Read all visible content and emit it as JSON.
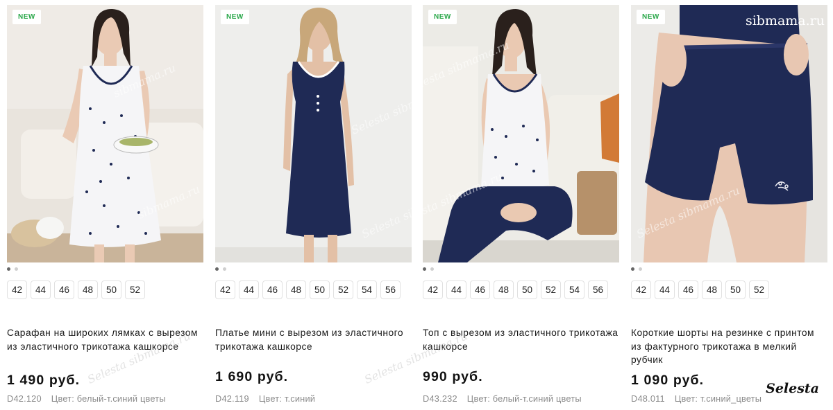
{
  "watermarks": {
    "top_right": "sibmama.ru",
    "diagonal_1": "Selesta sibmama.ru",
    "diagonal_2": "sibmama.ru",
    "signature": "Selesta"
  },
  "products": [
    {
      "badge": "NEW",
      "sizes": [
        "42",
        "44",
        "46",
        "48",
        "50",
        "52"
      ],
      "title": "Сарафан на широких лямках с вырезом из эластичного трикотажа кашкорсе",
      "price": "1 490 руб.",
      "article": "D42.120",
      "color": "Цвет: белый-т.синий цветы"
    },
    {
      "badge": "NEW",
      "sizes": [
        "42",
        "44",
        "46",
        "48",
        "50",
        "52",
        "54",
        "56"
      ],
      "title": "Платье мини с вырезом из эластичного трикотажа кашкорсе",
      "price": "1 690 руб.",
      "article": "D42.119",
      "color": "Цвет: т.синий"
    },
    {
      "badge": "NEW",
      "sizes": [
        "42",
        "44",
        "46",
        "48",
        "50",
        "52",
        "54",
        "56"
      ],
      "title": "Топ с вырезом из эластичного трикотажа кашкорсе",
      "price": "990 руб.",
      "article": "D43.232",
      "color": "Цвет: белый-т.синий цветы"
    },
    {
      "badge": "NEW",
      "sizes": [
        "42",
        "44",
        "46",
        "48",
        "50",
        "52"
      ],
      "title": "Короткие шорты на резинке с принтом из фактурного трикотажа в мелкий рубчик",
      "price": "1 090 руб.",
      "article": "D48.011",
      "color": "Цвет: т.синий_цветы"
    }
  ],
  "colors": {
    "badge_text": "#2aa84a",
    "navy": "#1f2a55",
    "price": "#111111",
    "meta": "#8a8a8a"
  }
}
